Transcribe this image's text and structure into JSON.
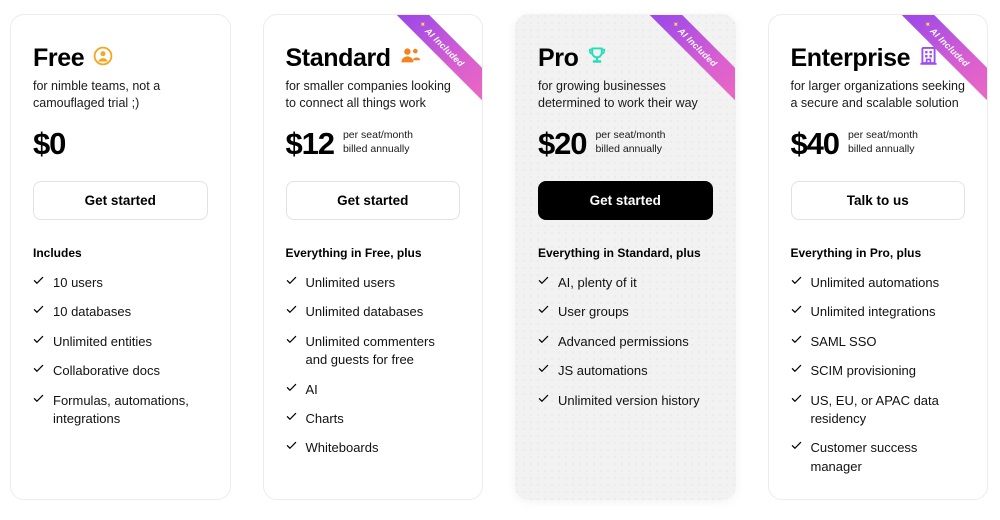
{
  "ribbon": {
    "label": "AI Included",
    "sparkle_icon": "sparkle-icon",
    "gradient_from": "#8b3dea",
    "gradient_to": "#f06bbf"
  },
  "plans": [
    {
      "name": "Free",
      "icon_name": "user-avatar-icon",
      "icon_glyph": "👤",
      "icon_color": "#f5a623",
      "tagline": "for nimble teams, not a camouflaged trial ;)",
      "price": "$0",
      "price_note_line1": "",
      "price_note_line2": "",
      "cta_label": "Get started",
      "cta_style": "outline",
      "ai_included": false,
      "highlighted": false,
      "features_title": "Includes",
      "features": [
        "10 users",
        "10 databases",
        "Unlimited entities",
        "Collaborative docs",
        "Formulas, automations, integrations"
      ]
    },
    {
      "name": "Standard",
      "icon_name": "people-group-icon",
      "icon_glyph": "👥",
      "icon_color": "#f5821f",
      "tagline": "for smaller companies looking to connect all things work",
      "price": "$12",
      "price_note_line1": "per seat/month",
      "price_note_line2": "billed annually",
      "cta_label": "Get started",
      "cta_style": "outline",
      "ai_included": true,
      "highlighted": false,
      "features_title": "Everything in Free, plus",
      "features": [
        "Unlimited users",
        "Unlimited databases",
        "Unlimited commenters and guests for free",
        "AI",
        "Charts",
        "Whiteboards"
      ]
    },
    {
      "name": "Pro",
      "icon_name": "trophy-icon",
      "icon_glyph": "🏆",
      "icon_color": "#22ddb8",
      "tagline": "for growing businesses determined to work their way",
      "price": "$20",
      "price_note_line1": "per seat/month",
      "price_note_line2": "billed annually",
      "cta_label": "Get started",
      "cta_style": "solid",
      "ai_included": true,
      "highlighted": true,
      "features_title": "Everything in Standard, plus",
      "features": [
        "AI, plenty of it",
        "User groups",
        "Advanced permissions",
        "JS automations",
        "Unlimited version history"
      ]
    },
    {
      "name": "Enterprise",
      "icon_name": "office-building-icon",
      "icon_glyph": "🏢",
      "icon_color": "#9a4ff0",
      "tagline": "for larger organizations seeking a secure and scalable solution",
      "price": "$40",
      "price_note_line1": "per seat/month",
      "price_note_line2": "billed annually",
      "cta_label": "Talk to us",
      "cta_style": "outline",
      "ai_included": true,
      "highlighted": false,
      "features_title": "Everything in Pro, plus",
      "features": [
        "Unlimited automations",
        "Unlimited integrations",
        "SAML SSO",
        "SCIM provisioning",
        "US, EU, or APAC data residency",
        "Customer success manager"
      ]
    }
  ]
}
